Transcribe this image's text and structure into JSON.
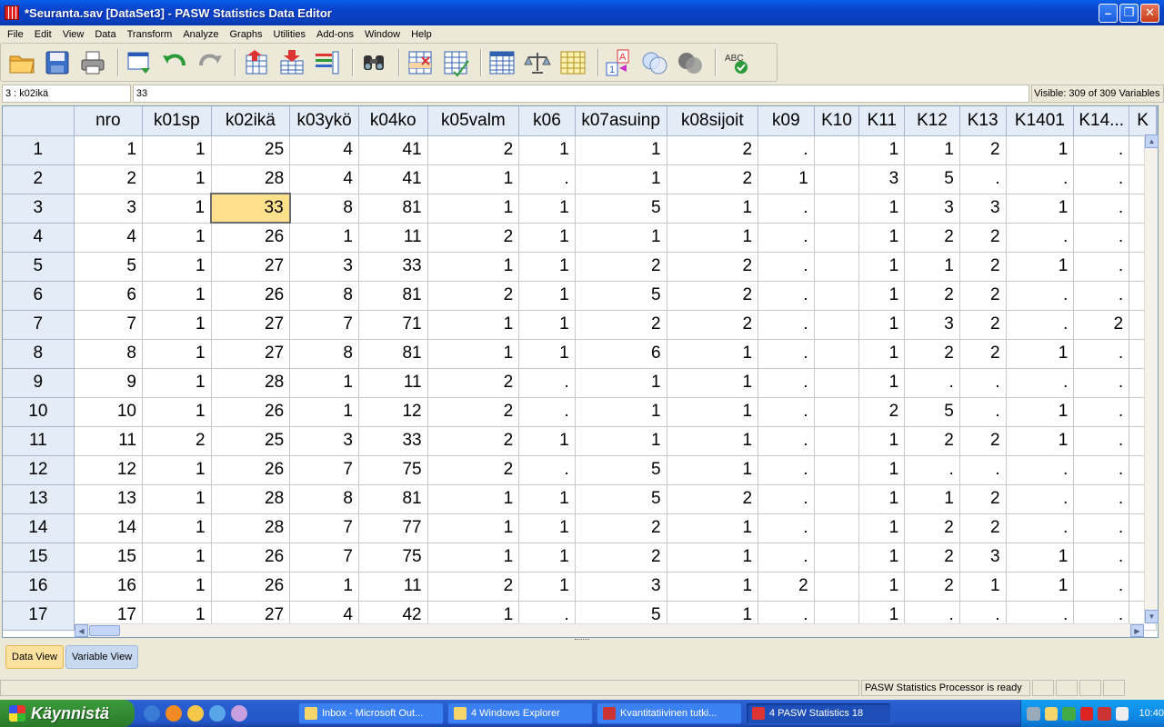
{
  "window": {
    "title": "*Seuranta.sav [DataSet3] - PASW Statistics Data Editor"
  },
  "menu": [
    "File",
    "Edit",
    "View",
    "Data",
    "Transform",
    "Analyze",
    "Graphs",
    "Utilities",
    "Add-ons",
    "Window",
    "Help"
  ],
  "toolbar": {
    "icons": [
      "open-folder-icon",
      "save-icon",
      "print-icon",
      "dialog-recall-icon",
      "undo-icon",
      "redo-icon",
      "goto-case-icon",
      "goto-variable-icon",
      "variables-icon",
      "find-icon",
      "insert-cases-icon",
      "insert-variable-icon",
      "split-file-icon",
      "weight-cases-icon",
      "select-cases-icon",
      "value-labels-icon",
      "use-variable-sets-icon",
      "show-all-variables-icon",
      "spell-check-icon"
    ]
  },
  "cellbar": {
    "ref": "3 : k02ikä",
    "value": "33",
    "visible": "Visible: 309 of 309 Variables"
  },
  "grid": {
    "columns": [
      "nro",
      "k01sp",
      "k02ikä",
      "k03ykö",
      "k04ko",
      "k05valm",
      "k06",
      "k07asuinp",
      "k08sijoit",
      "k09",
      "K10",
      "K11",
      "K12",
      "K13",
      "K1401",
      "K14...",
      "K"
    ],
    "rows": [
      [
        "1",
        "1",
        "1",
        "25",
        "4",
        "41",
        "2",
        "1",
        "1",
        "2",
        ".",
        "",
        "1",
        "1",
        "2",
        "1",
        ".",
        ""
      ],
      [
        "2",
        "2",
        "1",
        "28",
        "4",
        "41",
        "1",
        ".",
        "1",
        "2",
        "1",
        "",
        "3",
        "5",
        ".",
        ".",
        ".",
        ""
      ],
      [
        "3",
        "3",
        "1",
        "33",
        "8",
        "81",
        "1",
        "1",
        "5",
        "1",
        ".",
        "",
        "1",
        "3",
        "3",
        "1",
        ".",
        ""
      ],
      [
        "4",
        "4",
        "1",
        "26",
        "1",
        "11",
        "2",
        "1",
        "1",
        "1",
        ".",
        "",
        "1",
        "2",
        "2",
        ".",
        ".",
        ""
      ],
      [
        "5",
        "5",
        "1",
        "27",
        "3",
        "33",
        "1",
        "1",
        "2",
        "2",
        ".",
        "",
        "1",
        "1",
        "2",
        "1",
        ".",
        ""
      ],
      [
        "6",
        "6",
        "1",
        "26",
        "8",
        "81",
        "2",
        "1",
        "5",
        "2",
        ".",
        "",
        "1",
        "2",
        "2",
        ".",
        ".",
        ""
      ],
      [
        "7",
        "7",
        "1",
        "27",
        "7",
        "71",
        "1",
        "1",
        "2",
        "2",
        ".",
        "",
        "1",
        "3",
        "2",
        ".",
        "2",
        ""
      ],
      [
        "8",
        "8",
        "1",
        "27",
        "8",
        "81",
        "1",
        "1",
        "6",
        "1",
        ".",
        "",
        "1",
        "2",
        "2",
        "1",
        ".",
        ""
      ],
      [
        "9",
        "9",
        "1",
        "28",
        "1",
        "11",
        "2",
        ".",
        "1",
        "1",
        ".",
        "",
        "1",
        ".",
        ".",
        ".",
        ".",
        ""
      ],
      [
        "10",
        "10",
        "1",
        "26",
        "1",
        "12",
        "2",
        ".",
        "1",
        "1",
        ".",
        "",
        "2",
        "5",
        ".",
        "1",
        ".",
        ""
      ],
      [
        "11",
        "11",
        "2",
        "25",
        "3",
        "33",
        "2",
        "1",
        "1",
        "1",
        ".",
        "",
        "1",
        "2",
        "2",
        "1",
        ".",
        ""
      ],
      [
        "12",
        "12",
        "1",
        "26",
        "7",
        "75",
        "2",
        ".",
        "5",
        "1",
        ".",
        "",
        "1",
        ".",
        ".",
        ".",
        ".",
        ""
      ],
      [
        "13",
        "13",
        "1",
        "28",
        "8",
        "81",
        "1",
        "1",
        "5",
        "2",
        ".",
        "",
        "1",
        "1",
        "2",
        ".",
        ".",
        ""
      ],
      [
        "14",
        "14",
        "1",
        "28",
        "7",
        "77",
        "1",
        "1",
        "2",
        "1",
        ".",
        "",
        "1",
        "2",
        "2",
        ".",
        ".",
        ""
      ],
      [
        "15",
        "15",
        "1",
        "26",
        "7",
        "75",
        "1",
        "1",
        "2",
        "1",
        ".",
        "",
        "1",
        "2",
        "3",
        "1",
        ".",
        ""
      ],
      [
        "16",
        "16",
        "1",
        "26",
        "1",
        "11",
        "2",
        "1",
        "3",
        "1",
        "2",
        "",
        "1",
        "2",
        "1",
        "1",
        ".",
        ""
      ],
      [
        "17",
        "17",
        "1",
        "27",
        "4",
        "42",
        "1",
        ".",
        "5",
        "1",
        ".",
        "",
        "1",
        ".",
        ".",
        ".",
        ".",
        ""
      ]
    ],
    "selected": {
      "row": 2,
      "col": 2
    }
  },
  "tabs": {
    "data_view": "Data View",
    "variable_view": "Variable View"
  },
  "status": {
    "processor": "PASW Statistics Processor is ready"
  },
  "taskbar": {
    "start": "Käynnistä",
    "tasks": [
      "Inbox - Microsoft Out...",
      "4 Windows Explorer",
      "Kvantitatiivinen tutki...",
      "4 PASW Statistics 18"
    ],
    "clock": "10:40"
  }
}
